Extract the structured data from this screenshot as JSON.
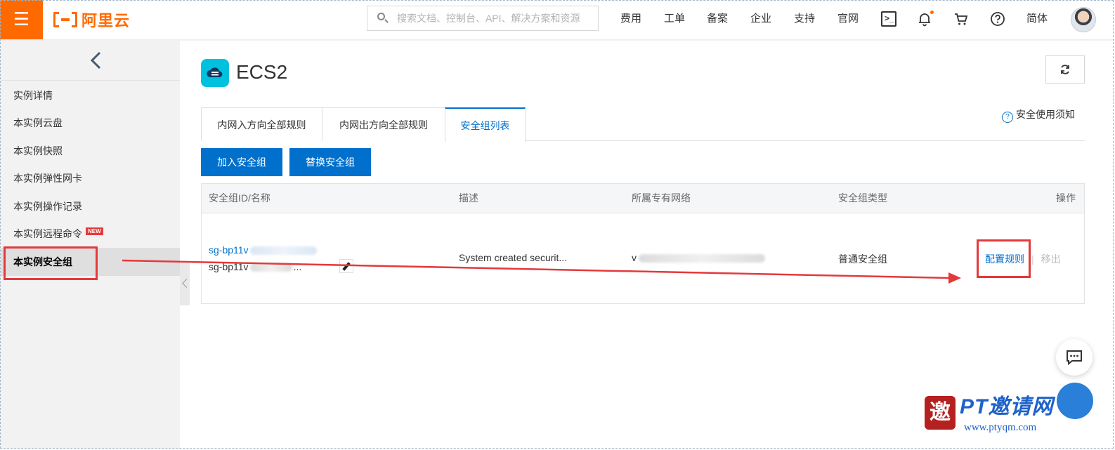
{
  "topbar": {
    "brand": "阿里云",
    "search_placeholder": "搜索文档、控制台、API、解决方案和资源",
    "nav": [
      "费用",
      "工单",
      "备案",
      "企业",
      "支持",
      "官网"
    ],
    "language": "简体"
  },
  "sidebar": {
    "items": [
      "实例详情",
      "本实例云盘",
      "本实例快照",
      "本实例弹性网卡",
      "本实例操作记录",
      "本实例远程命令",
      "本实例安全组"
    ],
    "new_badge": "NEW",
    "active_index": 6
  },
  "page": {
    "title": "ECS2",
    "tabs": [
      "内网入方向全部规则",
      "内网出方向全部规则",
      "安全组列表"
    ],
    "active_tab": 2,
    "help_link": "安全使用须知",
    "buttons": {
      "join": "加入安全组",
      "replace": "替换安全组"
    }
  },
  "table": {
    "headers": [
      "安全组ID/名称",
      "描述",
      "所属专有网络",
      "安全组类型",
      "操作"
    ],
    "row": {
      "id": "sg-bp11v",
      "name": "sg-bp11v",
      "name_suffix": "...",
      "description": "System created securit...",
      "vpc": "v",
      "type": "普通安全组",
      "action_config": "配置规则",
      "action_remove": "移出"
    }
  },
  "watermark": {
    "seal": "邀",
    "text": "PT邀请网",
    "url": "www.ptyqm.com"
  },
  "colors": {
    "brand_orange": "#ff6a00",
    "primary_blue": "#0070cc",
    "annotation_red": "#e4393c",
    "ecs_icon": "#00c1de"
  }
}
